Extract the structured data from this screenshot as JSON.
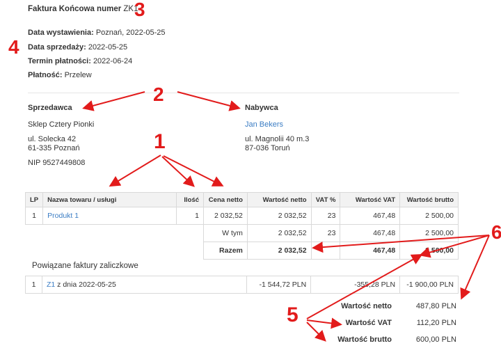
{
  "header": {
    "title_label": "Faktura Końcowa numer",
    "title_value": "ZK1",
    "issue_date_label": "Data wystawienia:",
    "issue_date_value": "Poznań, 2022-05-25",
    "sale_date_label": "Data sprzedaży:",
    "sale_date_value": "2022-05-25",
    "due_date_label": "Termin płatności:",
    "due_date_value": "2022-06-24",
    "payment_label": "Płatność:",
    "payment_value": "Przelew"
  },
  "seller": {
    "heading": "Sprzedawca",
    "name": "Sklep Cztery Pionki",
    "street": "ul. Solecka 42",
    "city": "61-335 Poznań",
    "nip": "NIP 9527449808"
  },
  "buyer": {
    "heading": "Nabywca",
    "name": "Jan Bekers",
    "street": "ul. Magnolii 40 m.3",
    "city": "87-036 Toruń"
  },
  "items_table": {
    "headers": [
      "LP",
      "Nazwa towaru / usługi",
      "Ilość",
      "Cena netto",
      "Wartość netto",
      "VAT %",
      "Wartość VAT",
      "Wartość brutto"
    ],
    "rows": [
      {
        "lp": "1",
        "name": "Produkt 1",
        "qty": "1",
        "unit_net": "2 032,52",
        "net": "2 032,52",
        "vat_rate": "23",
        "vat": "467,48",
        "gross": "2 500,00"
      }
    ],
    "in_that": {
      "label": "W tym",
      "net": "2 032,52",
      "vat_rate": "23",
      "vat": "467,48",
      "gross": "2 500,00"
    },
    "total": {
      "label": "Razem",
      "net": "2 032,52",
      "vat": "467,48",
      "gross": "2 500,00"
    }
  },
  "advances": {
    "heading": "Powiązane faktury zaliczkowe",
    "rows": [
      {
        "lp": "1",
        "invoice": "Z1",
        "date_text": "z dnia 2022-05-25",
        "net": "-1 544,72 PLN",
        "vat": "-355,28 PLN",
        "gross": "-1 900,00 PLN"
      }
    ]
  },
  "summary": {
    "net_label": "Wartość netto",
    "net_value": "487,80 PLN",
    "vat_label": "Wartość VAT",
    "vat_value": "112,20 PLN",
    "gross_label": "Wartość brutto",
    "gross_value": "600,00 PLN"
  },
  "annotations": {
    "n1": "1",
    "n2": "2",
    "n3": "3",
    "n4": "4",
    "n5": "5",
    "n6": "6"
  },
  "colors": {
    "annotation": "#e21b1b",
    "link": "#3b7dc4"
  }
}
